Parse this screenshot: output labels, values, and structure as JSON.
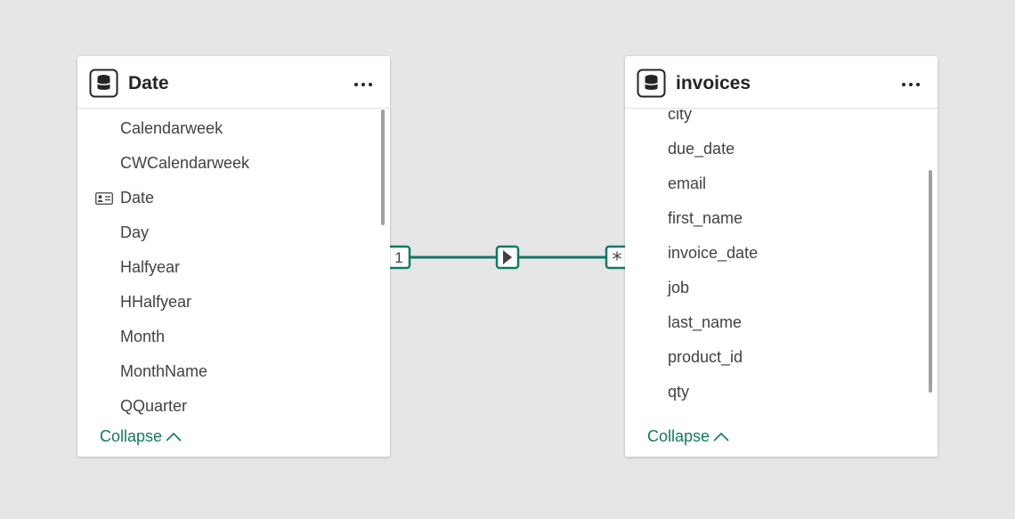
{
  "tables": [
    {
      "name": "Date",
      "fields": [
        "Calendarweek",
        "CWCalendarweek",
        "Date",
        "Day",
        "Halfyear",
        "HHalfyear",
        "Month",
        "MonthName",
        "QQuarter"
      ],
      "key_field": "Date",
      "collapse_label": "Collapse"
    },
    {
      "name": "invoices",
      "fields": [
        "city",
        "due_date",
        "email",
        "first_name",
        "invoice_date",
        "job",
        "last_name",
        "product_id",
        "qty"
      ],
      "collapse_label": "Collapse"
    }
  ],
  "relationship": {
    "from_cardinality": "1",
    "to_cardinality": "*",
    "direction": "single",
    "color": "#117865"
  },
  "colors": {
    "canvas": "#e6e6e6",
    "accent": "#117865",
    "text": "#424242"
  }
}
